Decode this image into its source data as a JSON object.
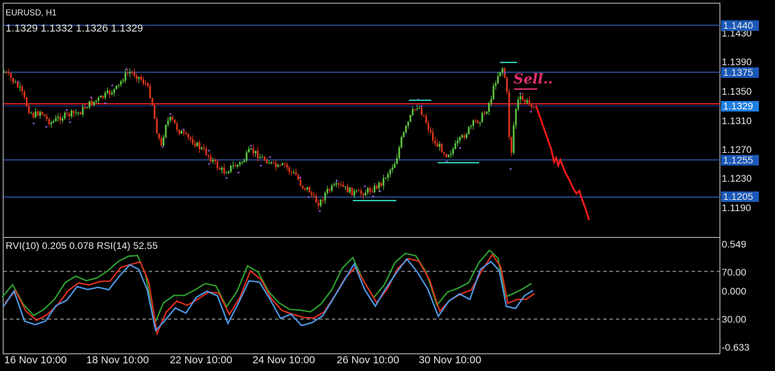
{
  "header": {
    "symbol": "EURUSD, H1",
    "ohlc": "1.1329 1.1332 1.1326 1.1329"
  },
  "annotation": {
    "sell_label": "Sell.."
  },
  "price_axis": {
    "ticks": [
      "1.1430",
      "1.1390",
      "1.1350",
      "1.1310",
      "1.1270",
      "1.1230",
      "1.1190"
    ],
    "levels": [
      "1.1440",
      "1.1375",
      "1.1255",
      "1.1205"
    ],
    "current": "1.1329"
  },
  "indicator": {
    "label": "RVI(10) 0.205 0.078 RSI(14) 52.55",
    "ticks": [
      "0.549",
      "70.00",
      "0.000",
      "30.00",
      "-0.633"
    ]
  },
  "time_axis": [
    "16 Nov 10:00",
    "18 Nov 10:00",
    "22 Nov 10:00",
    "24 Nov 10:00",
    "26 Nov 10:00",
    "30 Nov 10:00"
  ],
  "colors": {
    "bull": "#5ec843",
    "bear": "#e0361a",
    "level": "#3a66c4",
    "current": "#ff3030",
    "forecast": "#ff1a1a",
    "rvi_main": "#2fa02f",
    "rvi_signal": "#e03020",
    "rsi": "#4f9ae8",
    "fractal": "#8a55d8",
    "sell": "#e0306a",
    "support": "#2ec4b0"
  }
}
